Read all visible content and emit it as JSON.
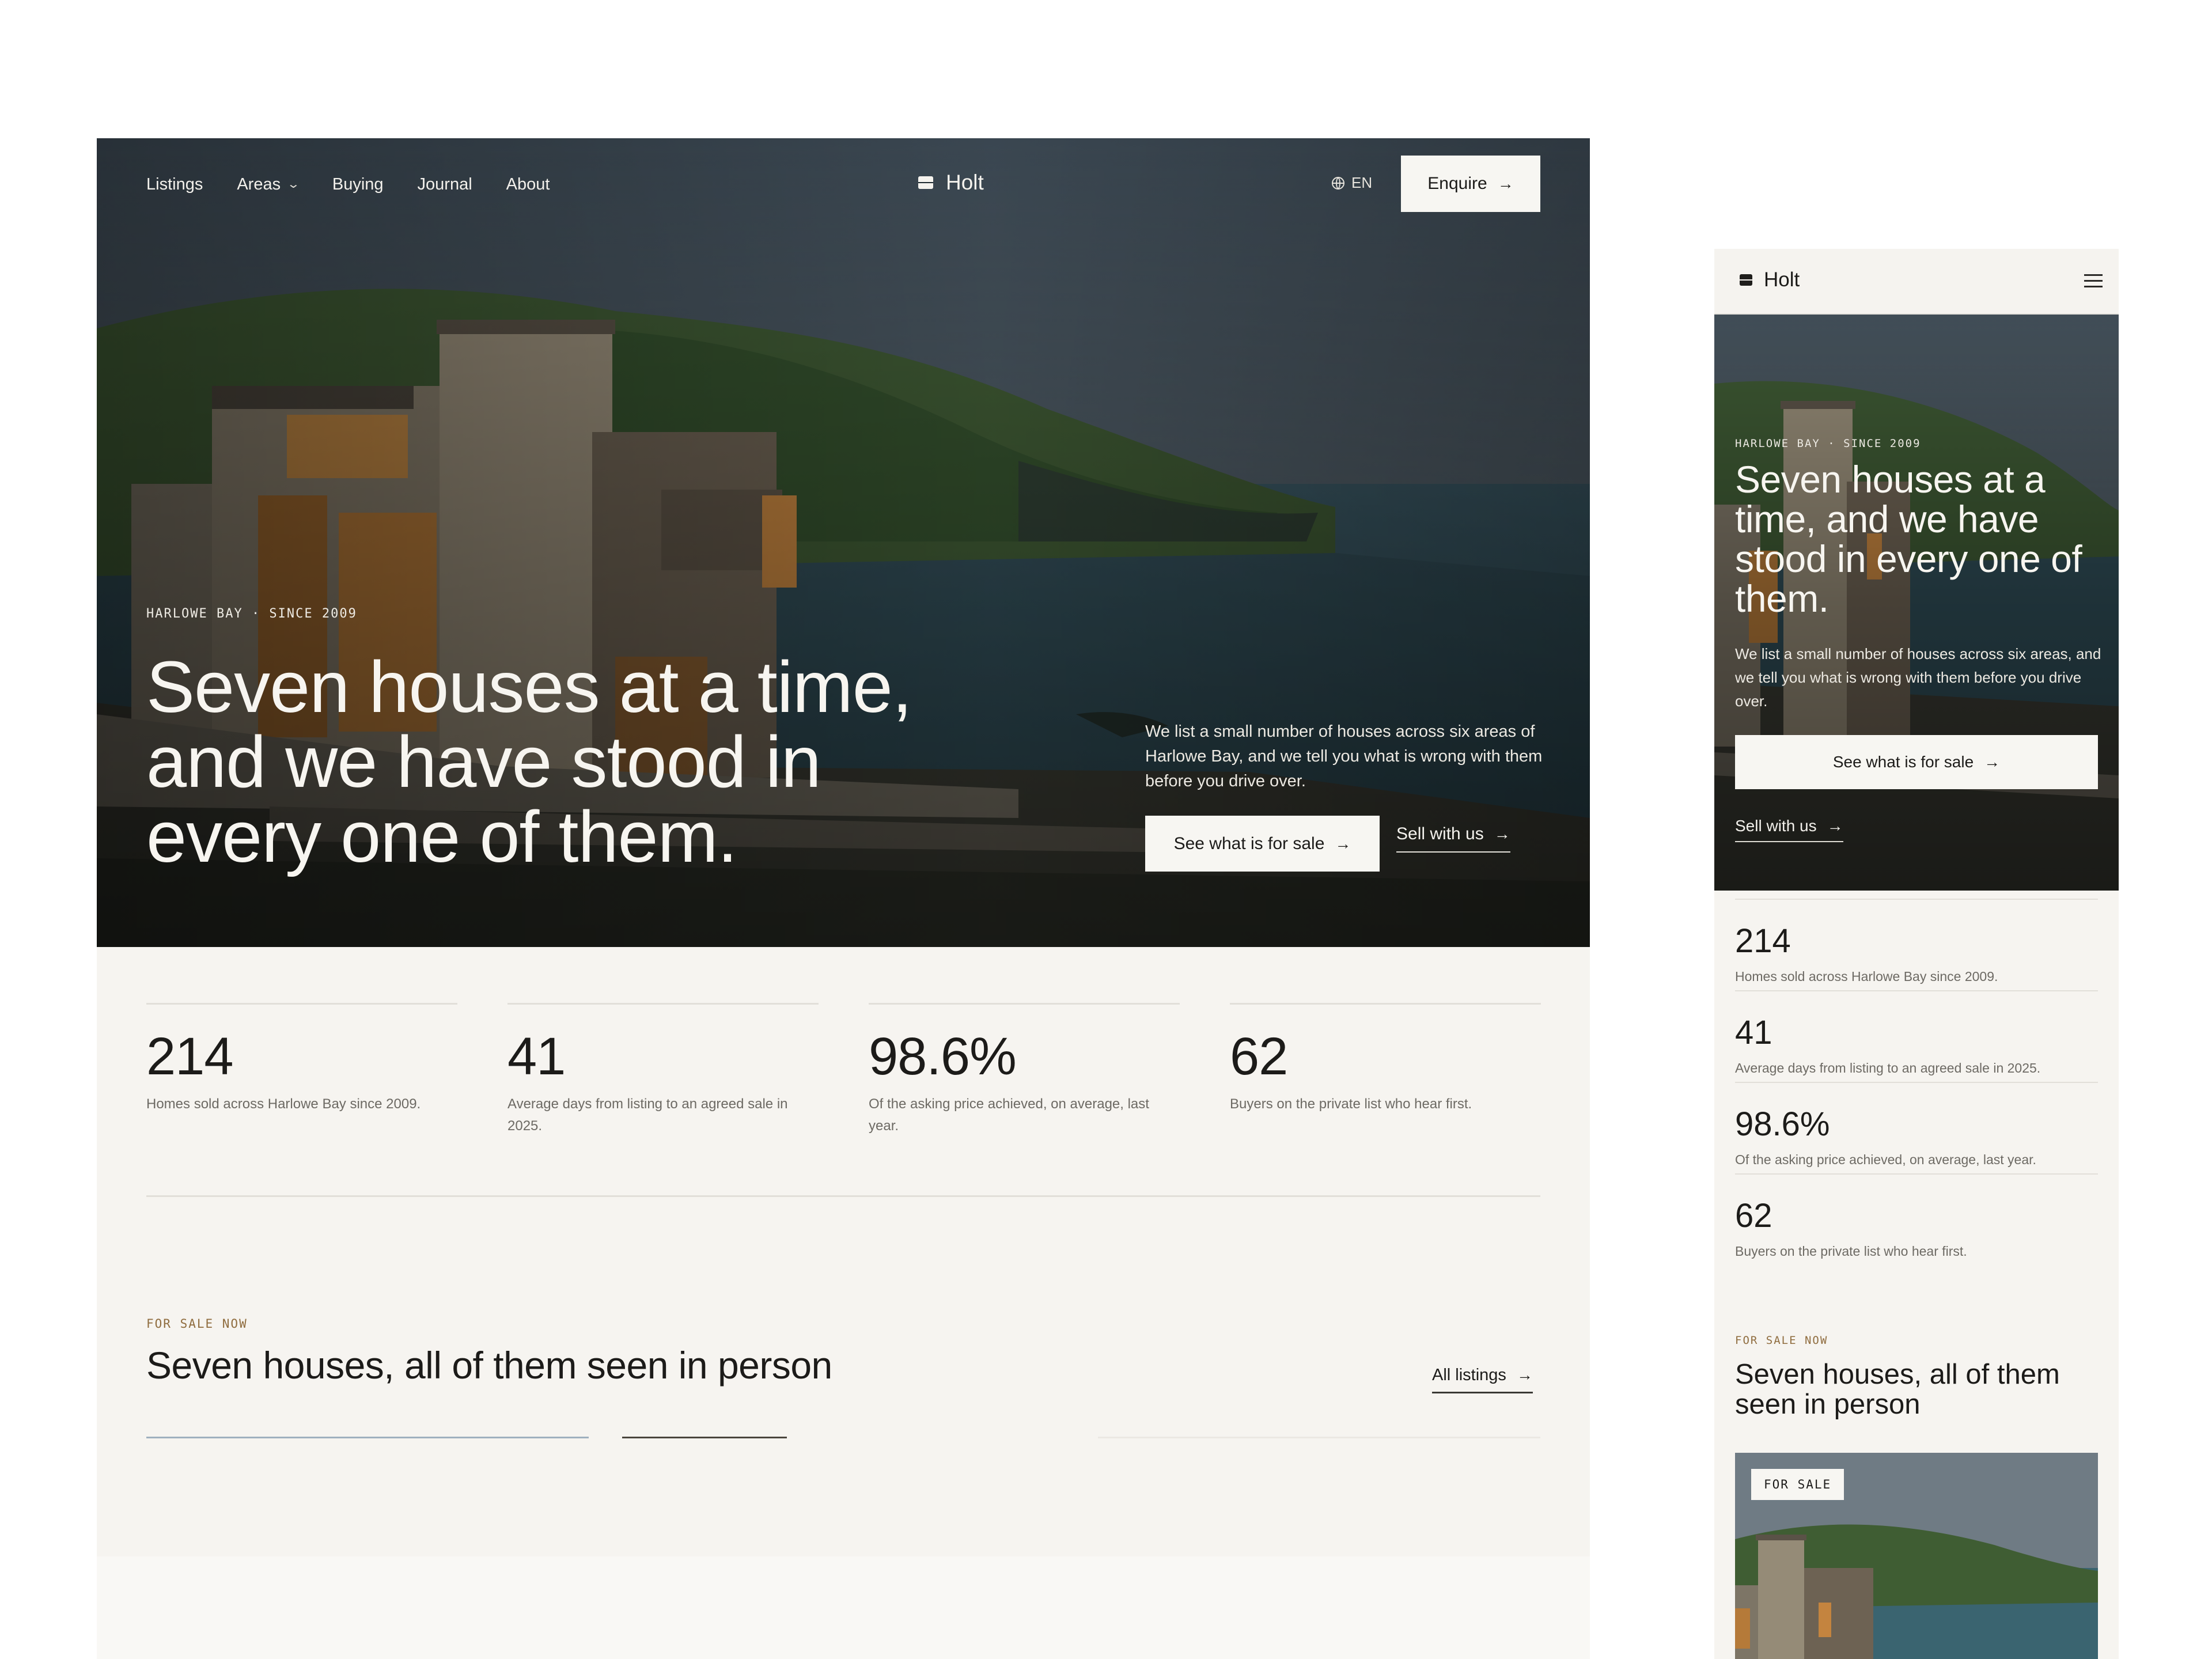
{
  "desktop": {
    "nav": [
      {
        "label": "Listings"
      },
      {
        "label": "Areas",
        "has_dropdown": true
      },
      {
        "label": "Buying"
      },
      {
        "label": "Journal"
      },
      {
        "label": "About"
      }
    ],
    "brand": "Holt",
    "language": "EN",
    "enquire_label": "Enquire",
    "hero": {
      "eyebrow": "HARLOWE BAY · SINCE 2009",
      "headline": "Seven houses at a time, and we have stood in every one of them.",
      "lede": "We list a small number of houses across six areas of Harlowe Bay, and we tell you what is wrong with them before you drive over.",
      "primary_cta": "See what is for sale",
      "secondary_cta": "Sell with us"
    },
    "stats": [
      {
        "value": "214",
        "label": "Homes sold across Harlowe Bay since 2009."
      },
      {
        "value": "41",
        "label": "Average days from listing to an agreed sale in 2025."
      },
      {
        "value": "98.6%",
        "label": "Of the asking price achieved, on average, last year."
      },
      {
        "value": "62",
        "label": "Buyers on the private list who hear first."
      }
    ],
    "for_sale": {
      "eyebrow": "FOR SALE NOW",
      "title": "Seven houses, all of them seen in person",
      "all_link": "All listings"
    }
  },
  "mobile": {
    "brand": "Holt",
    "menu_icon": "hamburger-menu-icon",
    "hero": {
      "eyebrow": "HARLOWE BAY · SINCE 2009",
      "headline": "Seven houses at a time, and we have stood in every one of them.",
      "lede": "We list a small number of houses across six areas, and we tell you what is wrong with them before you drive over.",
      "primary_cta": "See what is for sale",
      "secondary_cta": "Sell with us"
    },
    "stats": [
      {
        "value": "214",
        "label": "Homes sold across Harlowe Bay since 2009."
      },
      {
        "value": "41",
        "label": "Average days from listing to an agreed sale in 2025."
      },
      {
        "value": "98.6%",
        "label": "Of the asking price achieved, on average, last year."
      },
      {
        "value": "62",
        "label": "Buyers on the private list who hear first."
      }
    ],
    "for_sale": {
      "eyebrow": "FOR SALE NOW",
      "title": "Seven houses, all of them seen in person",
      "card_badge": "FOR SALE"
    }
  },
  "icons": {
    "arrow": "→",
    "chevron": "⌄"
  },
  "colors": {
    "page_bg": "#f6f4f0",
    "accent": "#8f6c3e",
    "ink": "#1c1b19",
    "button_bg": "#f7f6f2"
  }
}
